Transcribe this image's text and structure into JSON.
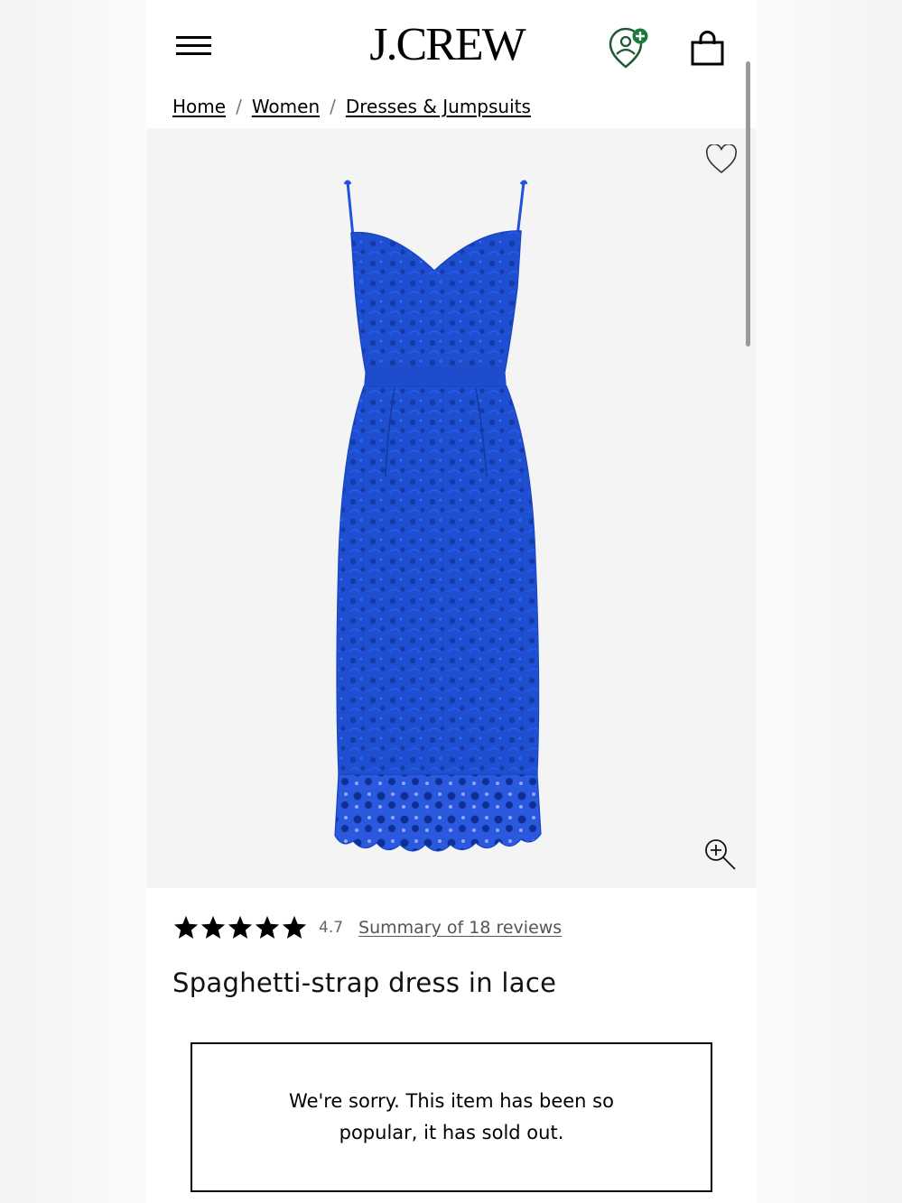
{
  "header": {
    "logo": "J.CREW",
    "icons": {
      "menu": "hamburger-menu-icon",
      "account": "account-rewards-icon",
      "bag": "shopping-bag-icon"
    },
    "accent_color": "#1a7a3c"
  },
  "breadcrumb": [
    "Home",
    "Women",
    "Dresses & Jumpsuits"
  ],
  "breadcrumb_separator": "/",
  "product": {
    "image": "blue-lace-dress",
    "dress_color": "#1f4fd1",
    "rating_value": 4.7,
    "rating_text": "4.7",
    "stars": 5,
    "reviews_link": "Summary of 18 reviews",
    "title": "Spaghetti-strap dress in lace"
  },
  "status": {
    "message": "We're sorry. This item has been so popular, it has sold out."
  }
}
